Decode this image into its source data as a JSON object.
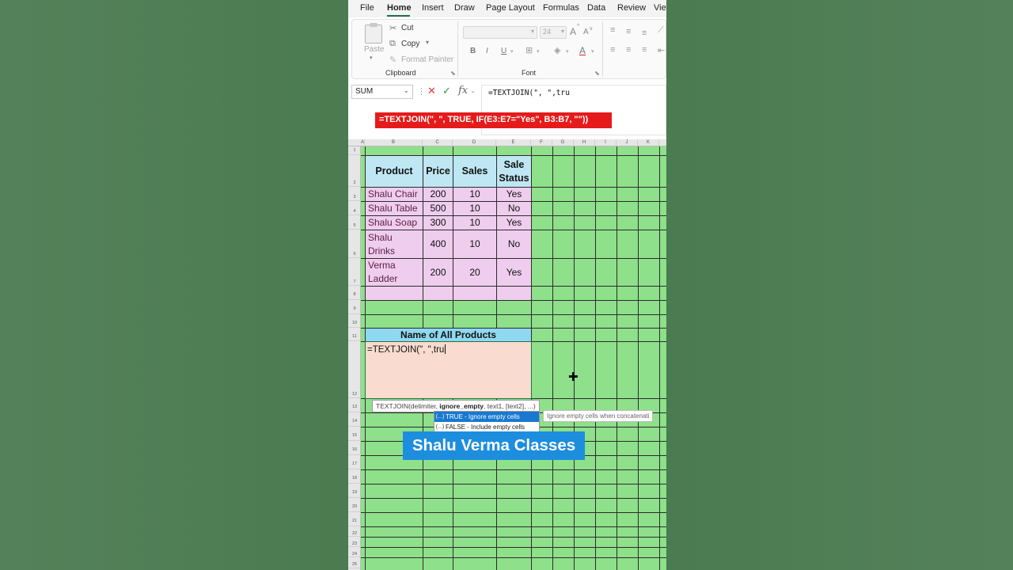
{
  "menu": {
    "tabs": [
      "File",
      "Home",
      "Insert",
      "Draw",
      "Page Layout",
      "Formulas",
      "Data",
      "Review",
      "View"
    ],
    "active": "Home"
  },
  "ribbon": {
    "clipboard": {
      "paste": "Paste",
      "cut": "Cut",
      "copy": "Copy",
      "format_painter": "Format Painter",
      "label": "Clipboard"
    },
    "font": {
      "size": "24",
      "label": "Font",
      "bold": "B",
      "italic": "I",
      "underline": "U",
      "grow": "A",
      "shrink": "A",
      "font_color": "A"
    }
  },
  "formula_bar": {
    "name_box": "SUM",
    "content": "=TEXTJOIN(\", \",tru"
  },
  "banner": "=TEXTJOIN(\", \", TRUE, IF(E3:E7=\"Yes\", B3:B7, \"\"))",
  "sheet": {
    "columns": [
      "A",
      "B",
      "C",
      "D",
      "E",
      "F",
      "G",
      "H",
      "I",
      "J",
      "K"
    ],
    "rows": [
      "1",
      "2",
      "3",
      "4",
      "5",
      "6",
      "7",
      "8",
      "9",
      "10",
      "11",
      "12",
      "13",
      "14",
      "15",
      "16",
      "17",
      "18",
      "19",
      "20",
      "21",
      "22",
      "23",
      "24",
      "25"
    ],
    "headers": [
      "Product",
      "Price",
      "Sales",
      "Sale Status"
    ],
    "data": [
      {
        "product": "Shalu Chair",
        "price": "200",
        "sales": "10",
        "status": "Yes"
      },
      {
        "product": "Shalu Table",
        "price": "500",
        "sales": "10",
        "status": "No"
      },
      {
        "product": "Shalu Soap",
        "price": "300",
        "sales": "10",
        "status": "Yes"
      },
      {
        "product": "Shalu Drinks",
        "price": "400",
        "sales": "10",
        "status": "No"
      },
      {
        "product": "Verma Ladder",
        "price": "200",
        "sales": "20",
        "status": "Yes"
      }
    ],
    "result_title": "Name of All Products",
    "editing_cell": "=TEXTJOIN(\", \",tru"
  },
  "tooltip": {
    "fn": "TEXTJOIN(",
    "arg1": "delimiter, ",
    "arg_bold": "ignore_empty",
    "rest": ", text1, [text2], ...)"
  },
  "autocomplete": {
    "items": [
      "TRUE - Ignore empty cells",
      "FALSE - Include empty cells"
    ],
    "description": "Ignore empty cells when concatenati"
  },
  "watermark": "Shalu Verma Classes",
  "colors": {
    "sheet_fill": "#8ee08a",
    "table_header": "#bfe6f3",
    "table_body": "#efcdee",
    "title_bar": "#8fd9f0",
    "edit_cell": "#f9dbcf",
    "banner": "#e51b1b",
    "watermark": "#1d8ede"
  }
}
